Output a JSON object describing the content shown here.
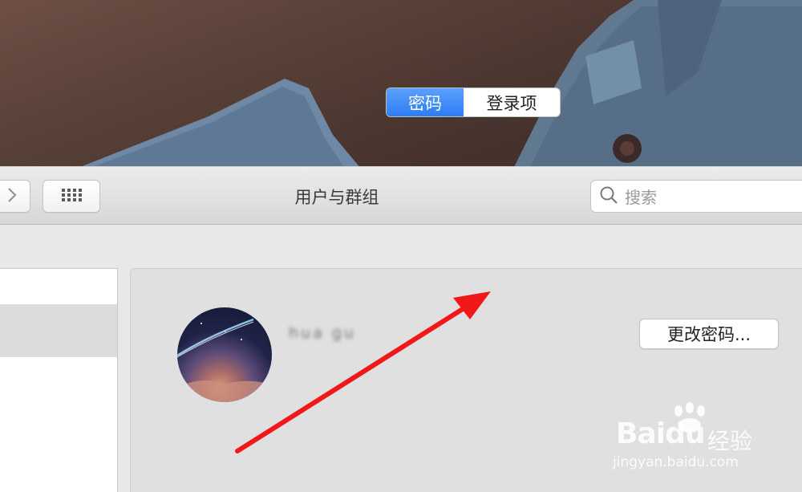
{
  "window": {
    "title": "用户与群组"
  },
  "toolbar": {
    "forward_icon": "chevron-right-icon",
    "grid_icon": "grid-icon",
    "search_placeholder": "搜索"
  },
  "tabs": [
    {
      "label": "密码",
      "selected": true
    },
    {
      "label": "登录项",
      "selected": false
    }
  ],
  "user": {
    "name": "hua gu"
  },
  "buttons": {
    "change_password": "更改密码..."
  },
  "annotation": {
    "color": "#f01818"
  },
  "watermark": {
    "logo": "Baidu",
    "cn": "经验",
    "url": "jingyan.baidu.com"
  },
  "colors": {
    "accent": "#2f7cf6"
  }
}
